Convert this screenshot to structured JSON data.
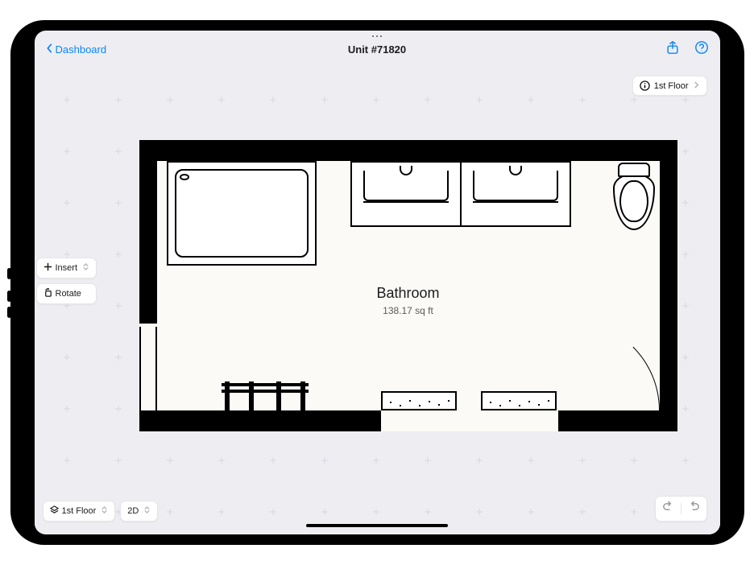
{
  "nav": {
    "back_label": "Dashboard",
    "title": "Unit  #71820"
  },
  "floor_pill": {
    "label": "1st Floor"
  },
  "tools": {
    "insert": "Insert",
    "rotate": "Rotate"
  },
  "bottom": {
    "floor": "1st Floor",
    "view_mode": "2D"
  },
  "room": {
    "name": "Bathroom",
    "area": "138.17 sq ft"
  }
}
